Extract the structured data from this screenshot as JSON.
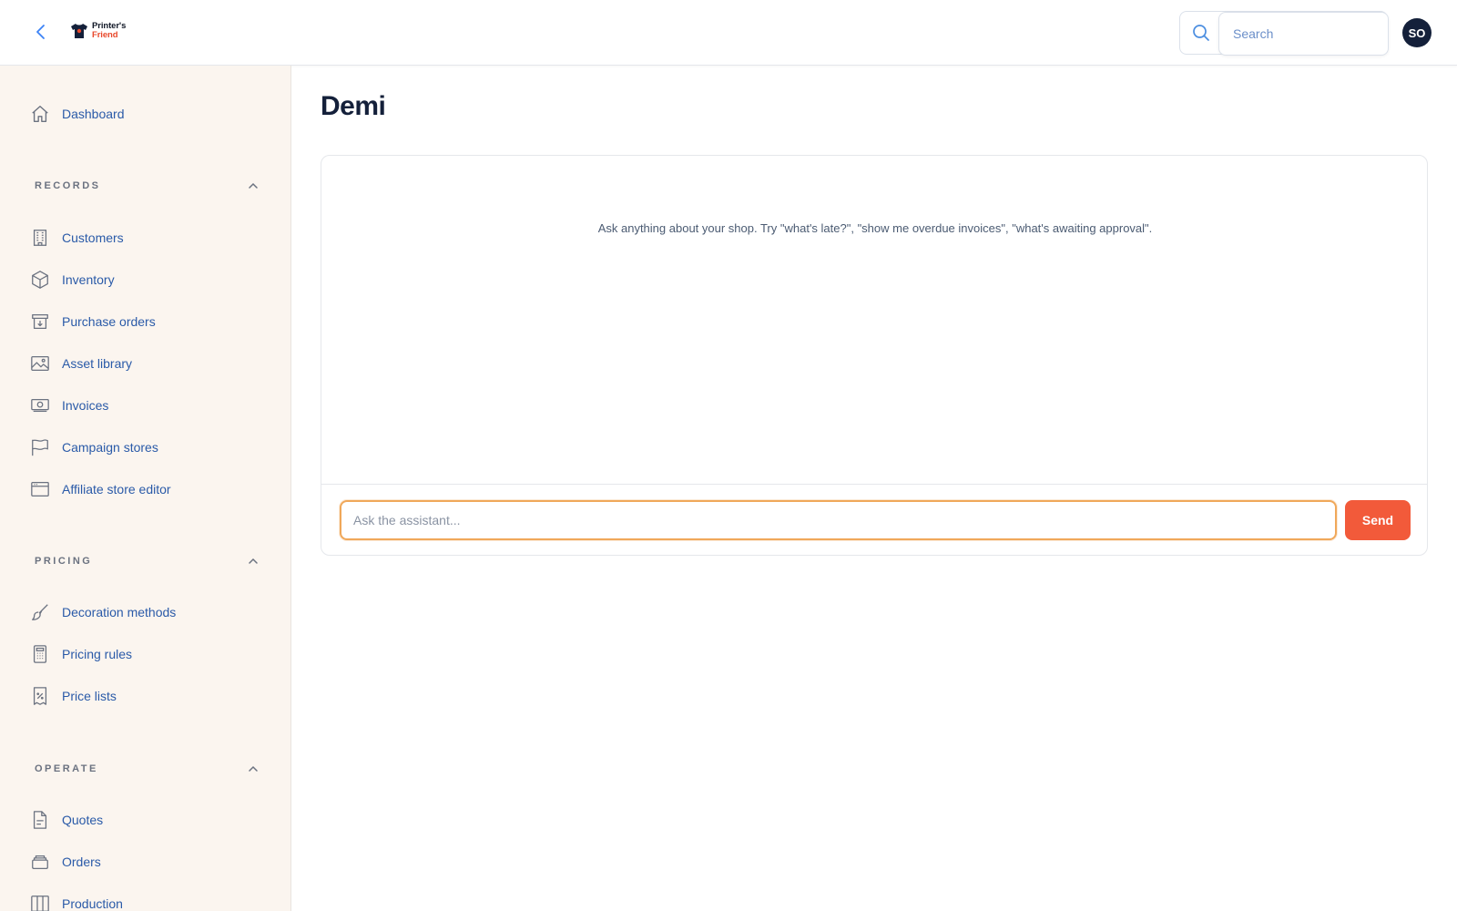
{
  "header": {
    "back_icon": "chevron-left-icon",
    "logo": {
      "line1": "Printer's",
      "line2": "Friend",
      "icon": "tshirt-icon"
    },
    "search": {
      "placeholder": "Search",
      "value": ""
    },
    "avatar_initials": "SO"
  },
  "sidebar": {
    "dashboard": {
      "label": "Dashboard",
      "icon": "home-icon"
    },
    "sections": [
      {
        "title": "RECORDS",
        "items": [
          {
            "label": "Customers",
            "icon": "building-icon"
          },
          {
            "label": "Inventory",
            "icon": "cube-icon"
          },
          {
            "label": "Purchase orders",
            "icon": "archive-download-icon"
          },
          {
            "label": "Asset library",
            "icon": "image-icon"
          },
          {
            "label": "Invoices",
            "icon": "banknote-icon"
          },
          {
            "label": "Campaign stores",
            "icon": "flag-icon"
          },
          {
            "label": "Affiliate store editor",
            "icon": "browser-window-icon"
          }
        ]
      },
      {
        "title": "PRICING",
        "items": [
          {
            "label": "Decoration methods",
            "icon": "paintbrush-icon"
          },
          {
            "label": "Pricing rules",
            "icon": "calculator-icon"
          },
          {
            "label": "Price lists",
            "icon": "receipt-percent-icon"
          }
        ]
      },
      {
        "title": "OPERATE",
        "items": [
          {
            "label": "Quotes",
            "icon": "document-text-icon"
          },
          {
            "label": "Orders",
            "icon": "stack-icon"
          },
          {
            "label": "Production",
            "icon": "columns-icon"
          }
        ]
      }
    ]
  },
  "main": {
    "title": "Demi",
    "hint": "Ask anything about your shop. Try \"what's late?\", \"show me overdue invoices\", \"what's awaiting approval\".",
    "input": {
      "placeholder": "Ask the assistant...",
      "value": ""
    },
    "send_label": "Send"
  },
  "colors": {
    "accent": "#f25a3a",
    "focus_ring": "#f0a85a",
    "sidebar_bg": "#fbf5ef",
    "link": "#2a5aa8",
    "avatar_bg": "#14203a"
  }
}
